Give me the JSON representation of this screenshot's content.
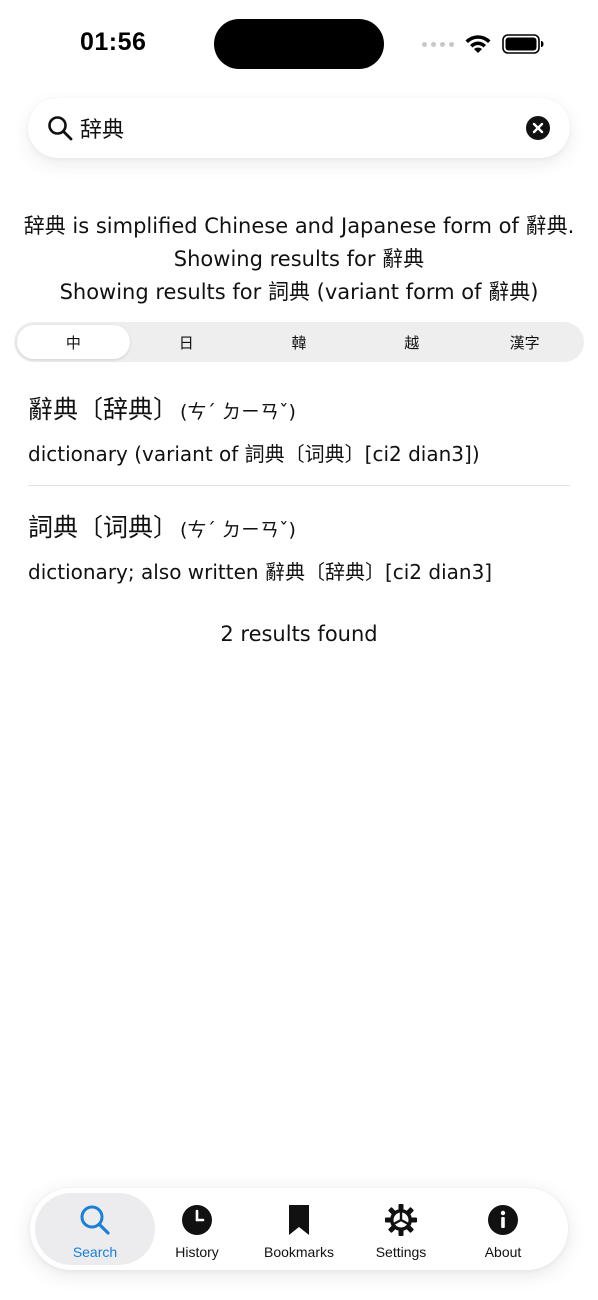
{
  "status_bar": {
    "time": "01:56"
  },
  "search": {
    "query": "辞典",
    "placeholder": ""
  },
  "info": {
    "line1": "辞典 is simplified Chinese and Japanese form of 辭典.",
    "line2": "Showing results for 辭典",
    "line3": "Showing results for 詞典 (variant form of 辭典)"
  },
  "segments": [
    {
      "label": "中",
      "selected": true
    },
    {
      "label": "日",
      "selected": false
    },
    {
      "label": "韓",
      "selected": false
    },
    {
      "label": "越",
      "selected": false
    },
    {
      "label": "漢字",
      "selected": false
    }
  ],
  "results": [
    {
      "word": "辭典〔辞典〕",
      "zhuyin": "(ㄘˊ ㄉㄧㄢˇ)",
      "definition": "dictionary (variant of 詞典〔词典〕[ci2 dian3])"
    },
    {
      "word": "詞典〔词典〕",
      "zhuyin": "(ㄘˊ ㄉㄧㄢˇ)",
      "definition": "dictionary; also written 辭典〔辞典〕[ci2 dian3]"
    }
  ],
  "results_count": "2 results found",
  "tabbar": {
    "tabs": [
      {
        "label": "Search",
        "icon": "search-icon",
        "active": true
      },
      {
        "label": "History",
        "icon": "clock-icon",
        "active": false
      },
      {
        "label": "Bookmarks",
        "icon": "bookmark-icon",
        "active": false
      },
      {
        "label": "Settings",
        "icon": "gear-icon",
        "active": false
      },
      {
        "label": "About",
        "icon": "info-icon",
        "active": false
      }
    ]
  },
  "colors": {
    "accent": "#1a7fd9",
    "text": "#111111",
    "segment_bg": "#eeeeef"
  }
}
